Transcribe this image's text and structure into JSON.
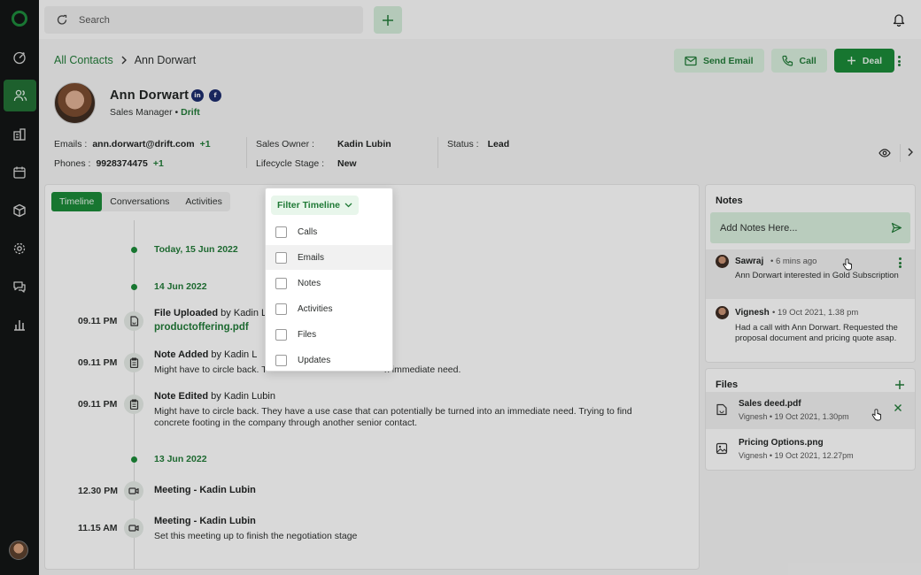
{
  "topbar": {
    "search_placeholder": "Search"
  },
  "breadcrumb": {
    "parent": "All Contacts",
    "current": "Ann Dorwart"
  },
  "actions": {
    "send_email": "Send Email",
    "call": "Call",
    "deal": "Deal"
  },
  "contact": {
    "name": "Ann Dorwart",
    "role": "Sales Manager",
    "company": "Drift",
    "linkedin_icon": "in",
    "facebook_icon": "f"
  },
  "fields": {
    "emails_label": "Emails :",
    "emails_value": "ann.dorwart@drift.com",
    "emails_extra": "+1",
    "phones_label": "Phones :",
    "phones_value": "9928374475",
    "phones_extra": "+1",
    "owner_label": "Sales Owner :",
    "owner_value": "Kadin Lubin",
    "lifecycle_label": "Lifecycle Stage :",
    "lifecycle_value": "New",
    "status_label": "Status :",
    "status_value": "Lead"
  },
  "tabs": {
    "timeline": "Timeline",
    "conversations": "Conversations",
    "activities": "Activities",
    "filter": "Filter Timeline"
  },
  "filter_options": [
    "Calls",
    "Emails",
    "Notes",
    "Activities",
    "Files",
    "Updates"
  ],
  "timeline": {
    "date1": "Today, 15 Jun 2022",
    "date2": "14 Jun 2022",
    "date3": "13 Jun 2022",
    "e1_time": "09.11 PM",
    "e1_title": "File Uploaded",
    "e1_by": " by Kadin L",
    "e1_link": "productoffering.pdf",
    "e2_time": "09.11 PM",
    "e2_title": "Note Added",
    "e2_by": " by Kadin L",
    "e2_body_a": "Might have to circle back. T",
    "e2_body_b": "n immediate need.",
    "e3_time": "09.11 PM",
    "e3_title": "Note Edited",
    "e3_by": " by Kadin Lubin",
    "e3_body": "Might have to circle back. They have a use case that can potentially be turned into an immediate need. Trying to find concrete footing in the company through another senior contact.",
    "e4_time": "12.30 PM",
    "e4_title": "Meeting - ",
    "e4_by": "Kadin Lubin",
    "e5_time": "11.15 AM",
    "e5_title": "Meeting - ",
    "e5_by": "Kadin Lubin",
    "e5_body": "Set this meeting up to finish the negotiation stage"
  },
  "notes": {
    "title": "Notes",
    "input_placeholder": "Add Notes Here...",
    "items": [
      {
        "author": "Sawraj",
        "time": "6 mins ago",
        "text": "Ann Dorwart interested in Gold Subscription"
      },
      {
        "author": "Vignesh",
        "time": "19 Oct 2021, 1.38 pm",
        "text": "Had a call with Ann Dorwart. Requested the proposal document and pricing quote asap."
      }
    ]
  },
  "files": {
    "title": "Files",
    "items": [
      {
        "name": "Sales deed.pdf",
        "author": "Vignesh",
        "time": "19 Oct 2021, 1.30pm"
      },
      {
        "name": "Pricing Options.png",
        "author": "Vignesh",
        "time": "19 Oct 2021, 12.27pm"
      }
    ]
  },
  "colors": {
    "brand_green": "#198a36",
    "link_green": "#1f7a36",
    "sidebar_bg": "#101312",
    "light_green": "#d9f0de"
  }
}
